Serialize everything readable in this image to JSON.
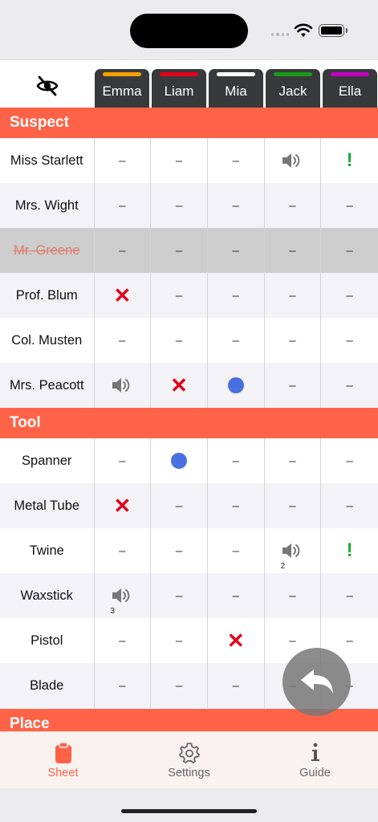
{
  "players": [
    {
      "name": "Emma",
      "color": "#f5a000"
    },
    {
      "name": "Liam",
      "color": "#e5001a"
    },
    {
      "name": "Mia",
      "color": "#ffffff"
    },
    {
      "name": "Jack",
      "color": "#1a9a1a"
    },
    {
      "name": "Ella",
      "color": "#c400c4"
    }
  ],
  "sections": [
    {
      "title": "Suspect",
      "rows": [
        {
          "name": "Miss Starlett",
          "crossed": false,
          "cells": [
            {
              "mark": "dash",
              "text": "–"
            },
            {
              "mark": "dash",
              "text": "–"
            },
            {
              "mark": "dash",
              "text": "–"
            },
            {
              "mark": "sound"
            },
            {
              "mark": "exclaim",
              "text": "!"
            }
          ]
        },
        {
          "name": "Mrs. Wight",
          "crossed": false,
          "cells": [
            {
              "mark": "dash",
              "text": "–"
            },
            {
              "mark": "dash",
              "text": "–"
            },
            {
              "mark": "dash",
              "text": "–"
            },
            {
              "mark": "dash",
              "text": "–"
            },
            {
              "mark": "dash",
              "text": "–"
            }
          ]
        },
        {
          "name": "Mr. Greene",
          "crossed": true,
          "cells": [
            {
              "mark": "dash",
              "text": "–"
            },
            {
              "mark": "dash",
              "text": "–"
            },
            {
              "mark": "dash",
              "text": "–"
            },
            {
              "mark": "dash",
              "text": "–"
            },
            {
              "mark": "dash",
              "text": "–"
            }
          ]
        },
        {
          "name": "Prof. Blum",
          "crossed": false,
          "cells": [
            {
              "mark": "x",
              "text": "✕"
            },
            {
              "mark": "dash",
              "text": "–"
            },
            {
              "mark": "dash",
              "text": "–"
            },
            {
              "mark": "dash",
              "text": "–"
            },
            {
              "mark": "dash",
              "text": "–"
            }
          ]
        },
        {
          "name": "Col. Musten",
          "crossed": false,
          "cells": [
            {
              "mark": "dash",
              "text": "–"
            },
            {
              "mark": "dash",
              "text": "–"
            },
            {
              "mark": "dash",
              "text": "–"
            },
            {
              "mark": "dash",
              "text": "–"
            },
            {
              "mark": "dash",
              "text": "–"
            }
          ]
        },
        {
          "name": "Mrs. Peacott",
          "crossed": false,
          "cells": [
            {
              "mark": "sound"
            },
            {
              "mark": "x",
              "text": "✕"
            },
            {
              "mark": "dot"
            },
            {
              "mark": "dash",
              "text": "–"
            },
            {
              "mark": "dash",
              "text": "–"
            }
          ]
        }
      ]
    },
    {
      "title": "Tool",
      "rows": [
        {
          "name": "Spanner",
          "crossed": false,
          "cells": [
            {
              "mark": "dash",
              "text": "–"
            },
            {
              "mark": "dot"
            },
            {
              "mark": "dash",
              "text": "–"
            },
            {
              "mark": "dash",
              "text": "–"
            },
            {
              "mark": "dash",
              "text": "–"
            }
          ]
        },
        {
          "name": "Metal Tube",
          "crossed": false,
          "cells": [
            {
              "mark": "x",
              "text": "✕"
            },
            {
              "mark": "dash",
              "text": "–"
            },
            {
              "mark": "dash",
              "text": "–"
            },
            {
              "mark": "dash",
              "text": "–"
            },
            {
              "mark": "dash",
              "text": "–"
            }
          ]
        },
        {
          "name": "Twine",
          "crossed": false,
          "cells": [
            {
              "mark": "dash",
              "text": "–"
            },
            {
              "mark": "dash",
              "text": "–"
            },
            {
              "mark": "dash",
              "text": "–"
            },
            {
              "mark": "sound",
              "count": "2"
            },
            {
              "mark": "exclaim",
              "text": "!"
            }
          ]
        },
        {
          "name": "Waxstick",
          "crossed": false,
          "cells": [
            {
              "mark": "sound",
              "count": "3"
            },
            {
              "mark": "dash",
              "text": "–"
            },
            {
              "mark": "dash",
              "text": "–"
            },
            {
              "mark": "dash",
              "text": "–"
            },
            {
              "mark": "dash",
              "text": "–"
            }
          ]
        },
        {
          "name": "Pistol",
          "crossed": false,
          "cells": [
            {
              "mark": "dash",
              "text": "–"
            },
            {
              "mark": "dash",
              "text": "–"
            },
            {
              "mark": "x",
              "text": "✕"
            },
            {
              "mark": "dash",
              "text": "–"
            },
            {
              "mark": "dash",
              "text": "–"
            }
          ]
        },
        {
          "name": "Blade",
          "crossed": false,
          "cells": [
            {
              "mark": "dash",
              "text": "–"
            },
            {
              "mark": "dash",
              "text": "–"
            },
            {
              "mark": "dash",
              "text": "–"
            },
            {
              "mark": "dash",
              "text": "–"
            },
            {
              "mark": "dash",
              "text": "–"
            }
          ]
        }
      ]
    },
    {
      "title": "Place",
      "rows": []
    }
  ],
  "tabbar": {
    "items": [
      {
        "label": "Sheet",
        "icon": "clipboard-icon",
        "active": true
      },
      {
        "label": "Settings",
        "icon": "gear-icon",
        "active": false
      },
      {
        "label": "Guide",
        "icon": "info-icon",
        "active": false
      }
    ]
  },
  "icons": {
    "header": "eye-slash-icon",
    "fab": "undo-arrow-icon"
  },
  "colors": {
    "accent": "#ff6347",
    "x": "#e0001a",
    "dot": "#4a6fe0",
    "exclaim": "#1fa83a"
  }
}
